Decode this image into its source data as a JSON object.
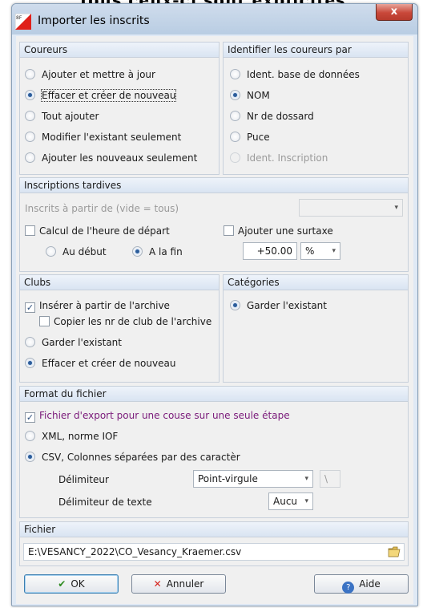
{
  "banner": "Tous ceux-ci sont explicites",
  "window": {
    "title": "Importer les inscrits",
    "close_label": "x"
  },
  "coureurs": {
    "title": "Coureurs",
    "options": [
      "Ajouter et mettre à jour",
      "Effacer et créer de nouveau",
      "Tout ajouter",
      "Modifier l'existant seulement",
      "Ajouter les nouveaux seulement"
    ],
    "selected_index": 1
  },
  "identifier": {
    "title": "Identifier les coureurs par",
    "options": [
      "Ident. base de données",
      "NOM",
      "Nr de dossard",
      "Puce",
      "Ident. Inscription"
    ],
    "selected_index": 1
  },
  "tardives": {
    "title": "Inscriptions tardives",
    "from_label": "Inscrits à partir de (vide = tous)",
    "from_value": "",
    "calc_label": "Calcul de l'heure de départ",
    "calc_checked": false,
    "start_label": "Au début",
    "end_label": "A la fin",
    "surtaxe_label": "Ajouter une surtaxe",
    "surtaxe_checked": false,
    "surtaxe_value": "+50.00",
    "surtaxe_unit": "%"
  },
  "clubs": {
    "title": "Clubs",
    "insert_label": "Insérer à partir de l'archive",
    "insert_checked": true,
    "copy_label": "Copier les nr de club de l'archive",
    "copy_checked": false,
    "keep_label": "Garder l'existant",
    "erase_label": "Effacer et créer de nouveau"
  },
  "categories": {
    "title": "Catégories",
    "keep_label": "Garder l'existant"
  },
  "format": {
    "title": "Format du fichier",
    "single_stage_label": "Fichier d'export pour une couse sur une seule étape",
    "single_stage_checked": true,
    "xml_label": "XML, norme IOF",
    "csv_label": "CSV, Colonnes séparées par des caractèr",
    "delim_label": "Délimiteur",
    "delim_value": "Point-virgule",
    "delim_other": "\\",
    "text_delim_label": "Délimiteur de texte",
    "text_delim_value": "Aucu"
  },
  "fichier": {
    "title": "Fichier",
    "path": "E:\\VESANCY_2022\\CO_Vesancy_Kraemer.csv"
  },
  "buttons": {
    "ok": "OK",
    "cancel": "Annuler",
    "help": "Aide"
  },
  "colors": {
    "accent": "#2d5d9a",
    "titlebar": "#c3d4e8",
    "purple_text": "#7a1a7a"
  }
}
